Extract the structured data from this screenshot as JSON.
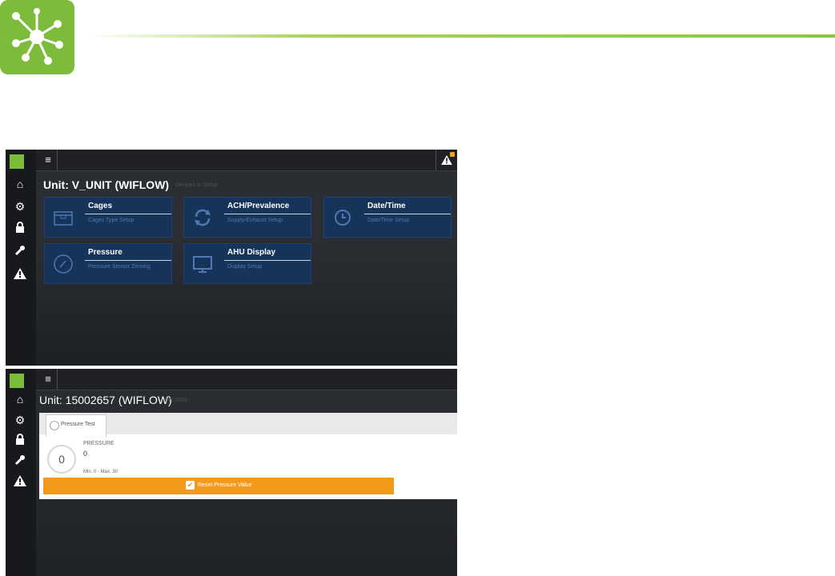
{
  "header": {
    "logo_icon": "network-nodes-icon",
    "accent_color": "#8cc63f"
  },
  "screen1": {
    "unit_title": "Unit: V_UNIT (WIFLOW)",
    "unit_sub": "Devices in Setup",
    "sidebar_icons": [
      "home-icon",
      "gears-icon",
      "lock-icon",
      "wrench-icon",
      "warning-icon"
    ],
    "tiles": [
      {
        "name": "Cages",
        "sub": "Cages Type Setup",
        "icon": "cage-box-icon"
      },
      {
        "name": "ACH/Prevalence",
        "sub": "Supply/Exhaust Setup",
        "icon": "refresh-icon"
      },
      {
        "name": "Date/Time",
        "sub": "Date/Time Setup",
        "icon": "clock-icon"
      },
      {
        "name": "Pressure",
        "sub": "Pressure Sensor Zeroing",
        "icon": "gauge-icon"
      },
      {
        "name": "AHU Display",
        "sub": "Display Setup",
        "icon": "monitor-icon"
      }
    ]
  },
  "screen2": {
    "unit_title": "Unit: 15002657 (WIFLOW)",
    "unit_sub": "SW 2020",
    "tab_label": "Pressure Test",
    "pressure_label": "PRESSURE",
    "pressure_value": "0",
    "gauge_value": "0",
    "range": "Min. 0 - Max. 30",
    "reset_label": "Reset Pressure Value"
  }
}
